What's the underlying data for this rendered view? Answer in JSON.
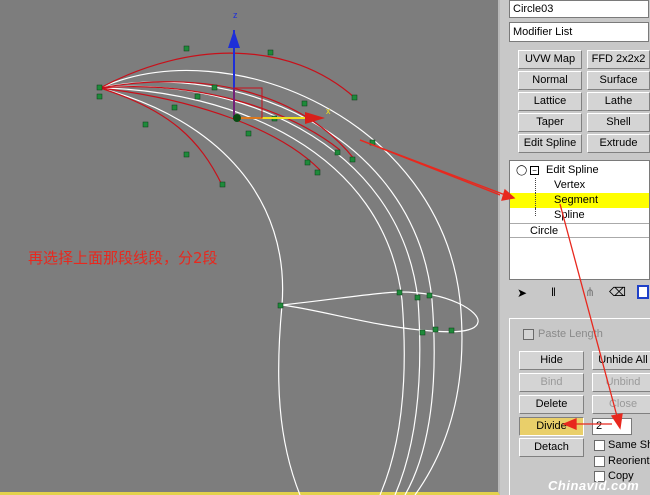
{
  "object_name": "Circle03",
  "modifier_list_label": "Modifier List",
  "modifier_buttons": [
    "UVW Map",
    "FFD 2x2x2",
    "Normal",
    "Surface",
    "Lattice",
    "Lathe",
    "Taper",
    "Shell",
    "Edit Spline",
    "Extrude"
  ],
  "stack": {
    "edit_spline": "Edit Spline",
    "vertex": "Vertex",
    "segment": "Segment",
    "spline": "Spline",
    "circle": "Circle"
  },
  "viewport": {
    "axis_z": "z",
    "axis_x": "x",
    "annotation": "再选择上面那段线段，分2段"
  },
  "rollout": {
    "paste_length": "Paste Length",
    "hide": "Hide",
    "unhide_all": "Unhide All",
    "bind": "Bind",
    "unbind": "Unbind",
    "delete": "Delete",
    "close": "Close",
    "divide": "Divide",
    "divide_value": "2",
    "detach": "Detach",
    "same_shp": "Same Shp",
    "reorient": "Reorient",
    "copy": "Copy"
  },
  "watermark": "Chinavid.com",
  "colors": {
    "viewport_bg": "#7d7d7d",
    "selected_segment": "#c8101a",
    "vertex": "#1e8a3a",
    "spline": "#ffffff",
    "highlight": "#ffff00",
    "annotation": "#e8281e"
  }
}
